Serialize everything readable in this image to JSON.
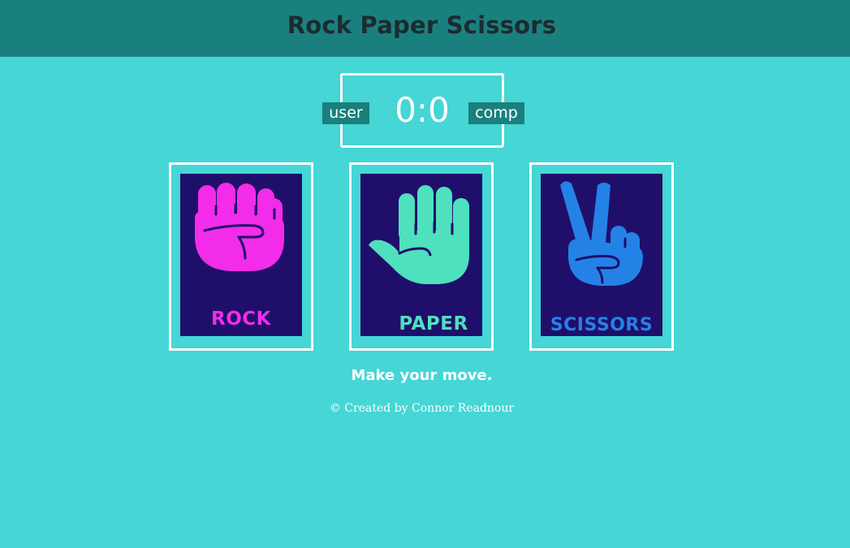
{
  "header": {
    "title": "Rock Paper Scissors"
  },
  "scoreboard": {
    "user_label": "user",
    "comp_label": "comp",
    "score": "0:0"
  },
  "choices": [
    {
      "id": "rock",
      "label": "ROCK",
      "color": "#f22ce8"
    },
    {
      "id": "paper",
      "label": "PAPER",
      "color": "#4fe0bd"
    },
    {
      "id": "scissors",
      "label": "SCISSORS",
      "color": "#2482e6"
    }
  ],
  "message": "Make your move.",
  "footer": "© Created by Connor Readnour",
  "colors": {
    "background": "#45d6d5",
    "header": "#1a807e",
    "card": "#1f0f6b"
  }
}
